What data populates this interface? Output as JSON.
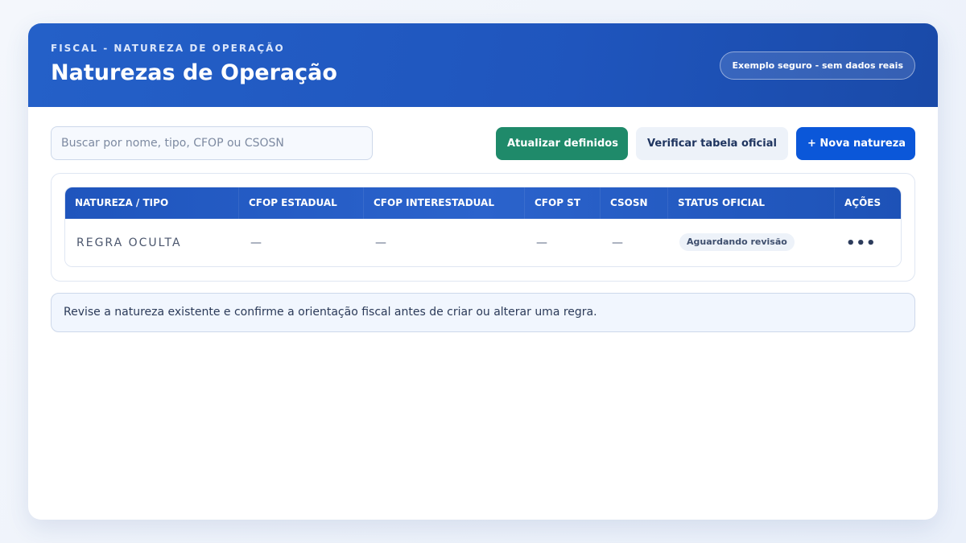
{
  "header": {
    "eyebrow": "FISCAL - NATUREZA DE OPERAÇÃO",
    "title": "Naturezas de Operação",
    "badge": "Exemplo seguro - sem dados reais"
  },
  "toolbar": {
    "search_placeholder": "Buscar por nome, tipo, CFOP ou CSOSN",
    "search_value": "",
    "update_label": "Atualizar definidos",
    "verify_label": "Verificar tabela oficial",
    "new_label": "+ Nova natureza"
  },
  "table": {
    "columns": [
      "NATUREZA / TIPO",
      "CFOP ESTADUAL",
      "CFOP INTERESTADUAL",
      "CFOP ST",
      "CSOSN",
      "STATUS OFICIAL",
      "AÇÕES"
    ],
    "rows": [
      {
        "name": "REGRA OCULTA",
        "cfop_estadual": "—",
        "cfop_interestadual": "—",
        "cfop_st": "—",
        "csosn": "—",
        "status": "Aguardando revisão",
        "actions_icon": "•••"
      }
    ]
  },
  "note": "Revise a natureza existente e confirme a orientação fiscal antes de criar ou alterar uma regra.",
  "colors": {
    "header_blue": "#1f55bd",
    "update_green": "#1f8a6a",
    "primary_blue": "#0b57d9"
  }
}
